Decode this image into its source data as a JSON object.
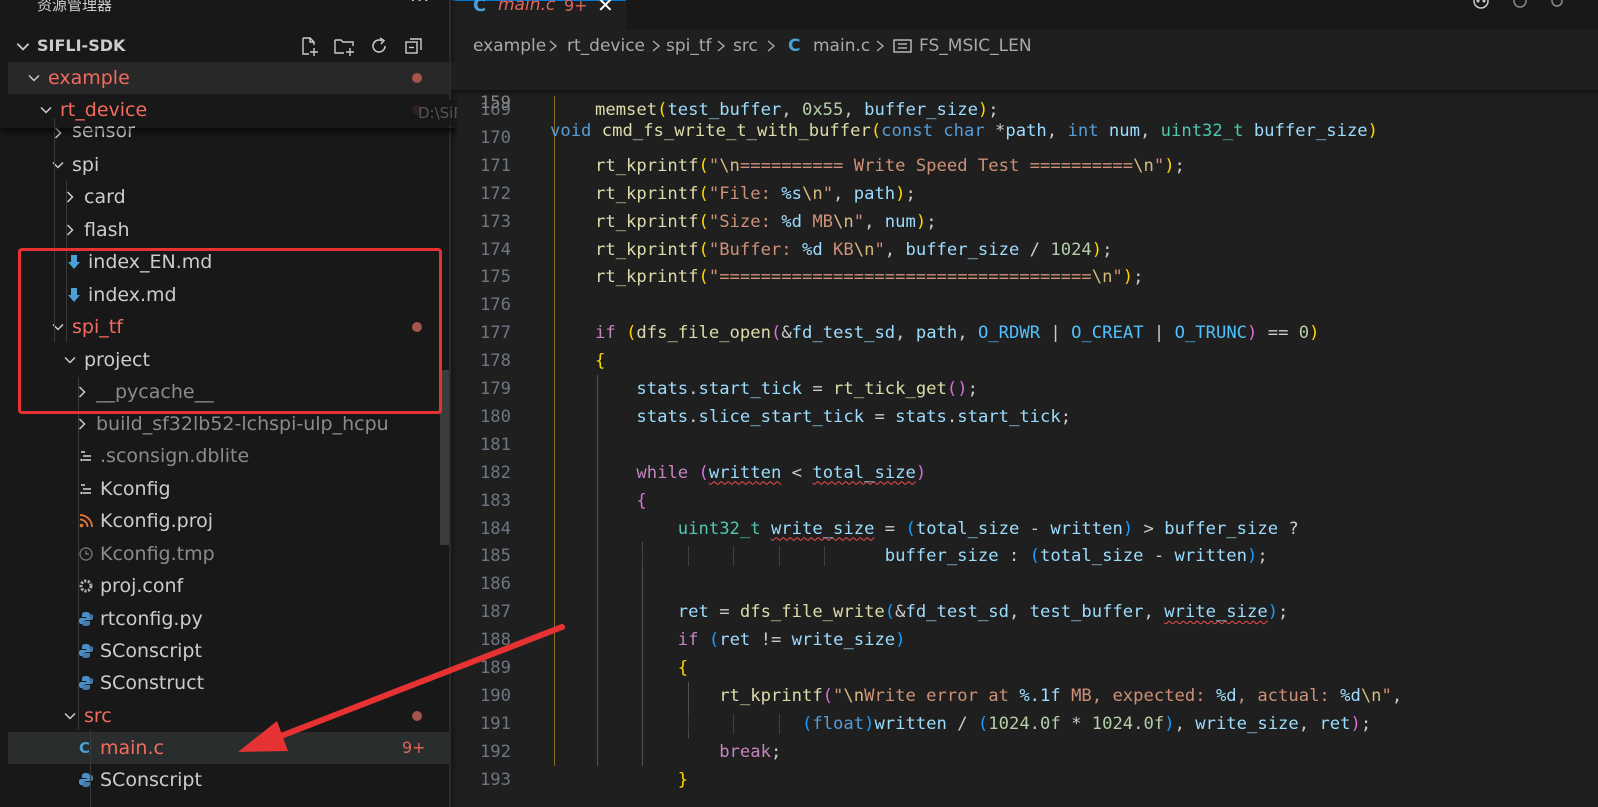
{
  "explorer": {
    "title": "资源管理器",
    "more": "···",
    "workspace": "SIFLI-SDK",
    "path_tooltip": "D:\\SiFli\\...\\sifli-sdk\\e..."
  },
  "tree": [
    {
      "label": "example",
      "kind": "folder-open",
      "color": "red",
      "dot": true
    },
    {
      "label": "rt_device",
      "kind": "folder-open",
      "color": "red",
      "dot": true
    },
    {
      "label": "sensor",
      "kind": "folder",
      "color": "normal"
    },
    {
      "label": "spi",
      "kind": "folder-open",
      "color": "normal"
    },
    {
      "label": "card",
      "kind": "folder",
      "color": "normal"
    },
    {
      "label": "flash",
      "kind": "folder",
      "color": "normal"
    },
    {
      "label": "index_EN.md",
      "kind": "markdown",
      "color": "normal"
    },
    {
      "label": "index.md",
      "kind": "markdown",
      "color": "normal"
    },
    {
      "label": "spi_tf",
      "kind": "folder-open",
      "color": "red",
      "dot": true
    },
    {
      "label": "project",
      "kind": "folder-open",
      "color": "normal"
    },
    {
      "label": "__pycache__",
      "kind": "folder",
      "color": "dim"
    },
    {
      "label": "build_sf32lb52-lchspi-ulp_hcpu",
      "kind": "folder",
      "color": "dim"
    },
    {
      "label": ".sconsign.dblite",
      "kind": "file-lines",
      "color": "dim"
    },
    {
      "label": "Kconfig",
      "kind": "file-lines",
      "color": "normal"
    },
    {
      "label": "Kconfig.proj",
      "kind": "rss",
      "color": "normal"
    },
    {
      "label": "Kconfig.tmp",
      "kind": "clock",
      "color": "dim"
    },
    {
      "label": "proj.conf",
      "kind": "gear",
      "color": "normal"
    },
    {
      "label": "rtconfig.py",
      "kind": "python",
      "color": "normal"
    },
    {
      "label": "SConscript",
      "kind": "python",
      "color": "normal"
    },
    {
      "label": "SConstruct",
      "kind": "python",
      "color": "normal"
    },
    {
      "label": "src",
      "kind": "folder-open",
      "color": "red",
      "dot": true
    },
    {
      "label": "main.c",
      "kind": "c",
      "color": "red",
      "badge": "9+",
      "selected": true
    },
    {
      "label": "SConscript",
      "kind": "python",
      "color": "normal"
    }
  ],
  "tab": {
    "icon": "C",
    "label": "main.c",
    "badge": "9+",
    "close": "✕"
  },
  "breadcrumb": [
    "example",
    "rt_device",
    "spi_tf",
    "src",
    "C",
    "main.c",
    "FS_MSIC_LEN"
  ],
  "sticky": {
    "ln": "159",
    "parts": [
      [
        "kw",
        "void"
      ],
      [
        "t",
        " "
      ],
      [
        "fn",
        "cmd_fs_write_t_with_buffer"
      ],
      [
        "b1",
        "("
      ],
      [
        "kw",
        "const"
      ],
      [
        "t",
        " "
      ],
      [
        "kw",
        "char"
      ],
      [
        "t",
        " *"
      ],
      [
        "var",
        "path"
      ],
      [
        "t",
        ", "
      ],
      [
        "kw",
        "int"
      ],
      [
        "t",
        " "
      ],
      [
        "var",
        "num"
      ],
      [
        "t",
        ", "
      ],
      [
        "ty",
        "uint32_t"
      ],
      [
        "t",
        " "
      ],
      [
        "var",
        "buffer_size"
      ],
      [
        "b1",
        ")"
      ]
    ]
  },
  "code": [
    {
      "ln": "169",
      "parts": [
        [
          "fn",
          "memset"
        ],
        [
          "b1",
          "("
        ],
        [
          "var",
          "test_buffer"
        ],
        [
          "t",
          ", "
        ],
        [
          "num",
          "0x55"
        ],
        [
          "t",
          ", "
        ],
        [
          "var",
          "buffer_size"
        ],
        [
          "b1",
          ")"
        ],
        [
          "t",
          ";"
        ]
      ]
    },
    {
      "ln": "170",
      "parts": []
    },
    {
      "ln": "171",
      "parts": [
        [
          "fn",
          "rt_kprintf"
        ],
        [
          "b1",
          "("
        ],
        [
          "str",
          "\""
        ],
        [
          "esc",
          "\\n"
        ],
        [
          "str",
          "========== Write Speed Test =========="
        ],
        [
          "esc",
          "\\n"
        ],
        [
          "str",
          "\""
        ],
        [
          "b1",
          ")"
        ],
        [
          "t",
          ";"
        ]
      ]
    },
    {
      "ln": "172",
      "parts": [
        [
          "fn",
          "rt_kprintf"
        ],
        [
          "b1",
          "("
        ],
        [
          "str",
          "\"File: "
        ],
        [
          "var",
          "%s"
        ],
        [
          "esc",
          "\\n"
        ],
        [
          "str",
          "\""
        ],
        [
          "t",
          ", "
        ],
        [
          "var",
          "path"
        ],
        [
          "b1",
          ")"
        ],
        [
          "t",
          ";"
        ]
      ]
    },
    {
      "ln": "173",
      "parts": [
        [
          "fn",
          "rt_kprintf"
        ],
        [
          "b1",
          "("
        ],
        [
          "str",
          "\"Size: "
        ],
        [
          "var",
          "%d"
        ],
        [
          "str",
          " MB"
        ],
        [
          "esc",
          "\\n"
        ],
        [
          "str",
          "\""
        ],
        [
          "t",
          ", "
        ],
        [
          "var",
          "num"
        ],
        [
          "b1",
          ")"
        ],
        [
          "t",
          ";"
        ]
      ]
    },
    {
      "ln": "174",
      "parts": [
        [
          "fn",
          "rt_kprintf"
        ],
        [
          "b1",
          "("
        ],
        [
          "str",
          "\"Buffer: "
        ],
        [
          "var",
          "%d"
        ],
        [
          "str",
          " KB"
        ],
        [
          "esc",
          "\\n"
        ],
        [
          "str",
          "\""
        ],
        [
          "t",
          ", "
        ],
        [
          "var",
          "buffer_size"
        ],
        [
          "t",
          " / "
        ],
        [
          "num",
          "1024"
        ],
        [
          "b1",
          ")"
        ],
        [
          "t",
          ";"
        ]
      ]
    },
    {
      "ln": "175",
      "parts": [
        [
          "fn",
          "rt_kprintf"
        ],
        [
          "b1",
          "("
        ],
        [
          "str",
          "\"===================================="
        ],
        [
          "esc",
          "\\n"
        ],
        [
          "str",
          "\""
        ],
        [
          "b1",
          ")"
        ],
        [
          "t",
          ";"
        ]
      ]
    },
    {
      "ln": "176",
      "parts": []
    },
    {
      "ln": "177",
      "parts": [
        [
          "kwc",
          "if"
        ],
        [
          "t",
          " "
        ],
        [
          "b1",
          "("
        ],
        [
          "fn",
          "dfs_file_open"
        ],
        [
          "b2",
          "("
        ],
        [
          "t",
          "&"
        ],
        [
          "var",
          "fd_test_sd"
        ],
        [
          "t",
          ", "
        ],
        [
          "var",
          "path"
        ],
        [
          "t",
          ", "
        ],
        [
          "mac",
          "O_RDWR"
        ],
        [
          "t",
          " | "
        ],
        [
          "mac",
          "O_CREAT"
        ],
        [
          "t",
          " | "
        ],
        [
          "mac",
          "O_TRUNC"
        ],
        [
          "b2",
          ")"
        ],
        [
          "t",
          " == "
        ],
        [
          "num",
          "0"
        ],
        [
          "b1",
          ")"
        ]
      ]
    },
    {
      "ln": "178",
      "parts": [
        [
          "b1",
          "{"
        ]
      ]
    },
    {
      "ln": "179",
      "parts": [
        [
          "t",
          "    "
        ],
        [
          "var",
          "stats"
        ],
        [
          "t",
          "."
        ],
        [
          "var",
          "start_tick"
        ],
        [
          "t",
          " = "
        ],
        [
          "fn",
          "rt_tick_get"
        ],
        [
          "b2",
          "()"
        ],
        [
          "t",
          ";"
        ]
      ]
    },
    {
      "ln": "180",
      "parts": [
        [
          "t",
          "    "
        ],
        [
          "var",
          "stats"
        ],
        [
          "t",
          "."
        ],
        [
          "var",
          "slice_start_tick"
        ],
        [
          "t",
          " = "
        ],
        [
          "var",
          "stats"
        ],
        [
          "t",
          "."
        ],
        [
          "var",
          "start_tick"
        ],
        [
          "t",
          ";"
        ]
      ]
    },
    {
      "ln": "181",
      "parts": []
    },
    {
      "ln": "182",
      "parts": [
        [
          "t",
          "    "
        ],
        [
          "kwc",
          "while"
        ],
        [
          "t",
          " "
        ],
        [
          "b2",
          "("
        ],
        [
          "varsq",
          "written"
        ],
        [
          "t",
          " < "
        ],
        [
          "varsq",
          "total_size"
        ],
        [
          "b2",
          ")"
        ]
      ]
    },
    {
      "ln": "183",
      "parts": [
        [
          "t",
          "    "
        ],
        [
          "b2",
          "{"
        ]
      ]
    },
    {
      "ln": "184",
      "parts": [
        [
          "t",
          "        "
        ],
        [
          "ty",
          "uint32_t"
        ],
        [
          "t",
          " "
        ],
        [
          "varsq",
          "write_size"
        ],
        [
          "t",
          " = "
        ],
        [
          "b3",
          "("
        ],
        [
          "var",
          "total_size"
        ],
        [
          "t",
          " - "
        ],
        [
          "var",
          "written"
        ],
        [
          "b3",
          ")"
        ],
        [
          "t",
          " > "
        ],
        [
          "var",
          "buffer_size"
        ],
        [
          "t",
          " ?"
        ]
      ]
    },
    {
      "ln": "185",
      "parts": [
        [
          "t",
          "                            "
        ],
        [
          "var",
          "buffer_size"
        ],
        [
          "t",
          " : "
        ],
        [
          "b3",
          "("
        ],
        [
          "var",
          "total_size"
        ],
        [
          "t",
          " - "
        ],
        [
          "var",
          "written"
        ],
        [
          "b3",
          ")"
        ],
        [
          "t",
          ";"
        ]
      ]
    },
    {
      "ln": "186",
      "parts": []
    },
    {
      "ln": "187",
      "parts": [
        [
          "t",
          "        "
        ],
        [
          "var",
          "ret"
        ],
        [
          "t",
          " = "
        ],
        [
          "fn",
          "dfs_file_write"
        ],
        [
          "b3",
          "("
        ],
        [
          "t",
          "&"
        ],
        [
          "var",
          "fd_test_sd"
        ],
        [
          "t",
          ", "
        ],
        [
          "var",
          "test_buffer"
        ],
        [
          "t",
          ", "
        ],
        [
          "varsq",
          "write_size"
        ],
        [
          "b3",
          ")"
        ],
        [
          "t",
          ";"
        ]
      ]
    },
    {
      "ln": "188",
      "parts": [
        [
          "t",
          "        "
        ],
        [
          "kwc",
          "if"
        ],
        [
          "t",
          " "
        ],
        [
          "b3",
          "("
        ],
        [
          "var",
          "ret"
        ],
        [
          "t",
          " != "
        ],
        [
          "var",
          "write_size"
        ],
        [
          "b3",
          ")"
        ]
      ]
    },
    {
      "ln": "189",
      "parts": [
        [
          "t",
          "        "
        ],
        [
          "b1",
          "{"
        ]
      ]
    },
    {
      "ln": "190",
      "parts": [
        [
          "t",
          "            "
        ],
        [
          "fn",
          "rt_kprintf"
        ],
        [
          "b2",
          "("
        ],
        [
          "str",
          "\""
        ],
        [
          "esc",
          "\\n"
        ],
        [
          "str",
          "Write error at "
        ],
        [
          "var",
          "%.1f"
        ],
        [
          "str",
          " MB, expected: "
        ],
        [
          "var",
          "%d"
        ],
        [
          "str",
          ", actual: "
        ],
        [
          "var",
          "%d"
        ],
        [
          "esc",
          "\\n"
        ],
        [
          "str",
          "\""
        ],
        [
          "t",
          ","
        ]
      ]
    },
    {
      "ln": "191",
      "parts": [
        [
          "t",
          "                    "
        ],
        [
          "b3",
          "("
        ],
        [
          "kw",
          "float"
        ],
        [
          "b3",
          ")"
        ],
        [
          "var",
          "written"
        ],
        [
          "t",
          " / "
        ],
        [
          "b3",
          "("
        ],
        [
          "num",
          "1024.0f"
        ],
        [
          "t",
          " * "
        ],
        [
          "num",
          "1024.0f"
        ],
        [
          "b3",
          ")"
        ],
        [
          "t",
          ", "
        ],
        [
          "var",
          "write_size"
        ],
        [
          "t",
          ", "
        ],
        [
          "var",
          "ret"
        ],
        [
          "b2",
          ")"
        ],
        [
          "t",
          ";"
        ]
      ]
    },
    {
      "ln": "192",
      "parts": [
        [
          "t",
          "            "
        ],
        [
          "kwc",
          "break"
        ],
        [
          "t",
          ";"
        ]
      ]
    },
    {
      "ln": "193",
      "parts": [
        [
          "t",
          "        "
        ],
        [
          "b1",
          "}"
        ]
      ]
    }
  ],
  "colors": {
    "accent": "#0078d4",
    "modified": "#f36b5e",
    "annotation": "#e63232"
  }
}
